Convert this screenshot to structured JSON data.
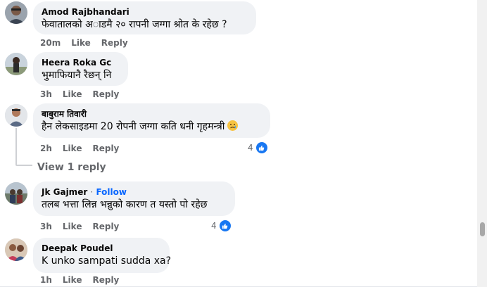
{
  "comments": [
    {
      "author": "Amod Rajbhandari",
      "text": "फेवातालको अाडमै २० रापनी जग्गा श्रोत के रहेछ ?",
      "time": "20m",
      "like": "Like",
      "reply": "Reply"
    },
    {
      "author": "Heera Roka Gc",
      "text": "भुमाफियानै रैछन् नि",
      "time": "3h",
      "like": "Like",
      "reply": "Reply"
    },
    {
      "author": "बाबुराम तिवारी",
      "text": "हैन लेकसाइडमा 20 रोपनी जग्गा कति धनी गृहमन्त्री",
      "time": "2h",
      "like": "Like",
      "reply": "Reply",
      "reaction_count": "4",
      "view_replies": "View 1 reply"
    },
    {
      "author": "Jk Gajmer",
      "separator": "·",
      "follow": "Follow",
      "text": "तलब भत्ता लिन्न भन्नुको कारण त यस्तो पो रहेछ",
      "time": "3h",
      "like": "Like",
      "reply": "Reply",
      "reaction_count": "4"
    },
    {
      "author": "Deepak Poudel",
      "text": "K unko sampati sudda xa?",
      "time": "1h",
      "like": "Like",
      "reply": "Reply"
    }
  ],
  "icons": {
    "reaction": "like-icon",
    "emoji": "sad-face-emoji"
  },
  "colors": {
    "bubble": "#f0f2f5",
    "meta": "#65676b",
    "follow": "#0866ff",
    "like_badge": "#1877f2"
  }
}
